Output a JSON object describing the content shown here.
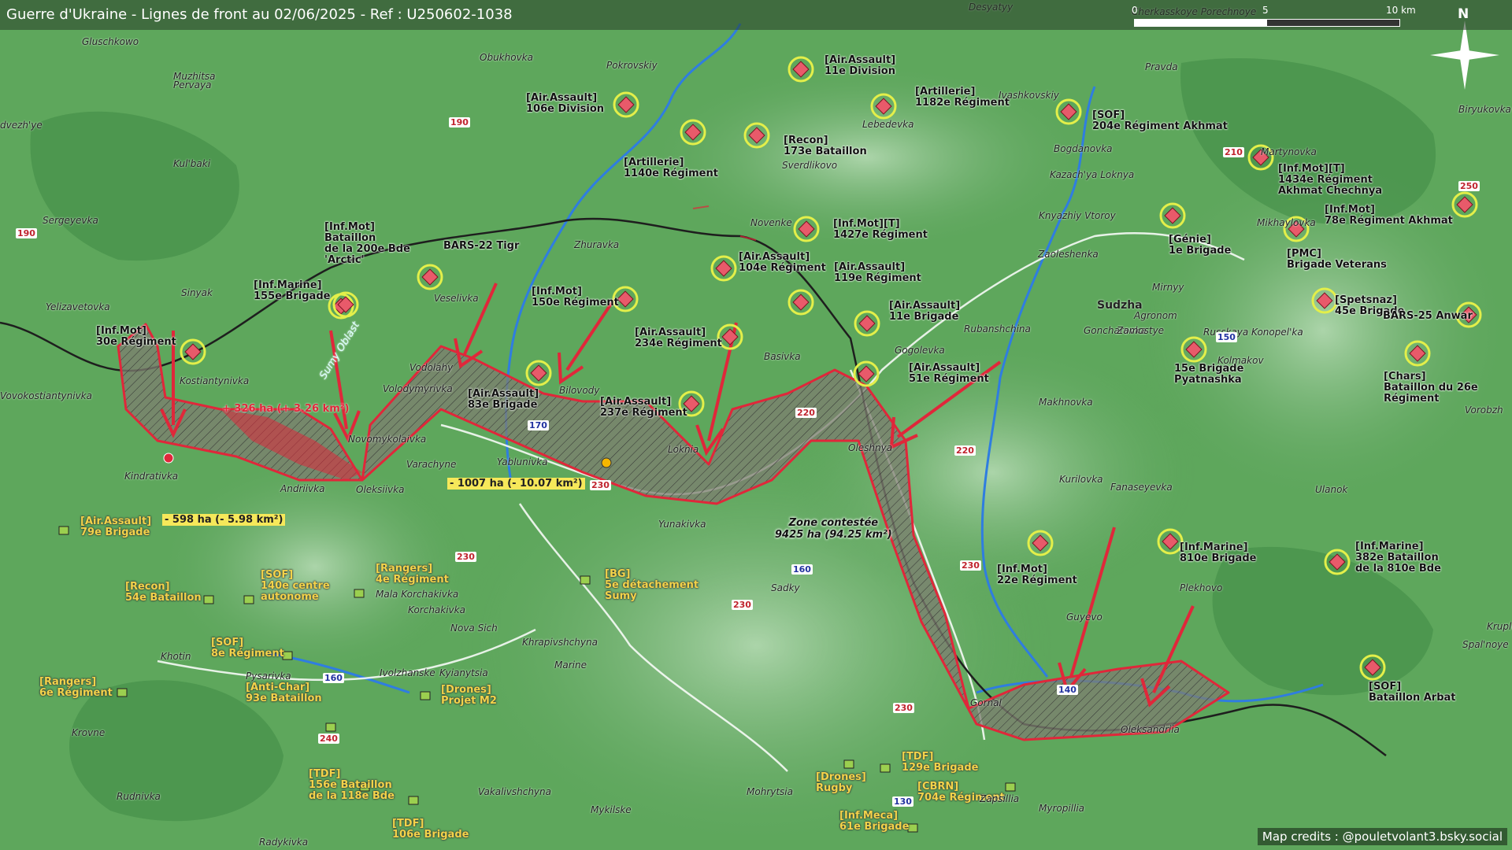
{
  "title": "Guerre d'Ukraine - Lignes de front au 02/06/2025 - Ref : U250602-1038",
  "scale": {
    "ticks": [
      "0",
      "5",
      "10 km"
    ]
  },
  "compass": "N",
  "credits": "Map credits : @pouletvolant3.bsky.social",
  "colors": {
    "russian_unit": "#e85a6a",
    "ukrainian_unit": "#9bcf4f",
    "front_line": "#e0273a",
    "ukraine_border": "#222222",
    "contested_fill": "#6a6a5a",
    "gain_fill": "#e0273a"
  },
  "russian_units": [
    {
      "lines": [
        "[Air.Assault]",
        "106e Division"
      ]
    },
    {
      "lines": [
        "[Air.Assault]",
        "11e Division"
      ]
    },
    {
      "lines": [
        "[Artillerie]",
        "1182e Régiment"
      ]
    },
    {
      "lines": [
        "[Recon]",
        "173e Bataillon"
      ]
    },
    {
      "lines": [
        "[Artillerie]",
        "1140e Régiment"
      ]
    },
    {
      "lines": [
        "[SOF]",
        "204e Régiment Akhmat"
      ]
    },
    {
      "lines": [
        "[Inf.Mot][T]",
        "1434e Régiment",
        "Akhmat Chechnya"
      ]
    },
    {
      "lines": [
        "[Inf.Mot]",
        "78e Régiment Akhmat"
      ]
    },
    {
      "lines": [
        "[Génie]",
        "1e Brigade"
      ]
    },
    {
      "lines": [
        "[PMC]",
        "Brigade Veterans"
      ]
    },
    {
      "lines": [
        "[Spetsnaz]",
        "45e Brigade"
      ]
    },
    {
      "lines": [
        "BARS-25 Anwar"
      ]
    },
    {
      "lines": [
        "[Inf.Mot][T]",
        "1427e Régiment"
      ]
    },
    {
      "lines": [
        "[Air.Assault]",
        "104e Régiment"
      ]
    },
    {
      "lines": [
        "[Air.Assault]",
        "119e Régiment"
      ]
    },
    {
      "lines": [
        "[Air.Assault]",
        "11e Brigade"
      ]
    },
    {
      "lines": [
        "[Inf.Mot]",
        "Bataillon",
        "de la 200e Bde",
        "'Arctic'"
      ]
    },
    {
      "lines": [
        "BARS-22 Tigr"
      ]
    },
    {
      "lines": [
        "[Inf.Marine]",
        "155e Brigade"
      ]
    },
    {
      "lines": [
        "[Inf.Mot]",
        "150e Régiment"
      ]
    },
    {
      "lines": [
        "[Inf.Mot]",
        "30e Régiment"
      ]
    },
    {
      "lines": [
        "[Air.Assault]",
        "234e Régiment"
      ]
    },
    {
      "lines": [
        "[Air.Assault]",
        "83e Brigade"
      ]
    },
    {
      "lines": [
        "[Air.Assault]",
        "237e Régiment"
      ]
    },
    {
      "lines": [
        "[Air.Assault]",
        "51e Régiment"
      ]
    },
    {
      "lines": [
        "15e Brigade",
        "Pyatnashka"
      ]
    },
    {
      "lines": [
        "[Chars]",
        "Bataillon du 26e",
        "Régiment"
      ]
    },
    {
      "lines": [
        "[Inf.Mot]",
        "22e Régiment"
      ]
    },
    {
      "lines": [
        "[Inf.Marine]",
        "810e Brigade"
      ]
    },
    {
      "lines": [
        "[Inf.Marine]",
        "382e Bataillon",
        "de la 810e Bde"
      ]
    },
    {
      "lines": [
        "[SOF]",
        "Bataillon Arbat"
      ]
    }
  ],
  "ukrainian_units": [
    {
      "lines": [
        "[Air.Assault]",
        "79e Brigade"
      ]
    },
    {
      "lines": [
        "[Recon]",
        "54e Bataillon"
      ]
    },
    {
      "lines": [
        "[SOF]",
        "140e centre",
        "autonome"
      ]
    },
    {
      "lines": [
        "[Rangers]",
        "4e Régiment"
      ]
    },
    {
      "lines": [
        "[BG]",
        "5e détachement",
        "Sumy"
      ]
    },
    {
      "lines": [
        "[SOF]",
        "8e Régiment"
      ]
    },
    {
      "lines": [
        "[Rangers]",
        "6e Régiment"
      ]
    },
    {
      "lines": [
        "[Drones]",
        "Projet M2"
      ]
    },
    {
      "lines": [
        "[Anti-Char]",
        "93e Bataillon"
      ]
    },
    {
      "lines": [
        "[TDF]",
        "156e Bataillon",
        "de la 118e Bde"
      ]
    },
    {
      "lines": [
        "[TDF]",
        "106e Brigade"
      ]
    },
    {
      "lines": [
        "[Drones]",
        "Rugby"
      ]
    },
    {
      "lines": [
        "[TDF]",
        "129e Brigade"
      ]
    },
    {
      "lines": [
        "[CBRN]",
        "704e Régiment"
      ]
    },
    {
      "lines": [
        "[Inf.Meca]",
        "61e Brigade"
      ]
    }
  ],
  "area_labels": {
    "gain": "+ 326 ha (+ 3.26 km²)",
    "loss_1": "- 1007 ha (- 10.07 km²)",
    "loss_2": "- 598 ha (- 5.98 km²)",
    "contested": [
      "Zone contestée",
      "9425 ha (94.25 km²)"
    ],
    "oblast": "Sumy Oblast"
  },
  "towns": [
    "Desyatyy",
    "Gluschkowo",
    "Obukhovka",
    "Pokrovskiy",
    "Muzhitsa",
    "Pervaya",
    "dvezh'ye",
    "Kul'baki",
    "Sergeyevka",
    "Yelizavetovka",
    "Sinyak",
    "Kostiantynivka",
    "Vovokostiantynivka",
    "Kindrativka",
    "Oleksiivka",
    "Andriivka",
    "Novomykolaivka",
    "Volodymyrivka",
    "Vodolahy",
    "Veselivka",
    "Zhuravka",
    "Bilovody",
    "Yablunivka",
    "Varachyne",
    "Yunakivka",
    "Loknia",
    "Basivka",
    "Novenke",
    "Sverdlikovo",
    "Lebedevka",
    "Ivashkovskiy",
    "Pravda",
    "Cherkasskoye Porechnoye",
    "Bogdanovka",
    "Kazach'ya Loknya",
    "Knyazhiy Vtoroy",
    "Zaoleshenka",
    "Sudzha",
    "Mirnyy",
    "Goncharovka",
    "Zamostye",
    "Rubanshchina",
    "Gogolevka",
    "Oleshnya",
    "Makhnovka",
    "Kurilovka",
    "Fanaseyevka",
    "Agronom",
    "Kolmakov",
    "Russkaya Konopel'ka",
    "Martynovka",
    "Mikhaylovka",
    "Biryukovka",
    "Ulanok",
    "Vorobzh",
    "Spal'noye",
    "Kruple",
    "Plekhovo",
    "Guyevo",
    "Gornal",
    "Oleksandriia",
    "Zapsillia",
    "Myropillia",
    "Mohrytsia",
    "Mykilske",
    "Sadky",
    "Khrapivshchyna",
    "Marine",
    "Nova Sich",
    "Korchakivka",
    "Mala Korchakivka",
    "Khotin",
    "Pysarivka",
    "Ivolzhanske",
    "Kyianytsia",
    "Krovne",
    "Rudnivka",
    "Vakalivshchyna",
    "Radykivka"
  ],
  "roads": [
    "190",
    "190",
    "210",
    "250",
    "150",
    "170",
    "220",
    "220",
    "230",
    "230",
    "230",
    "230",
    "160",
    "140",
    "160",
    "240",
    "130",
    "230"
  ]
}
